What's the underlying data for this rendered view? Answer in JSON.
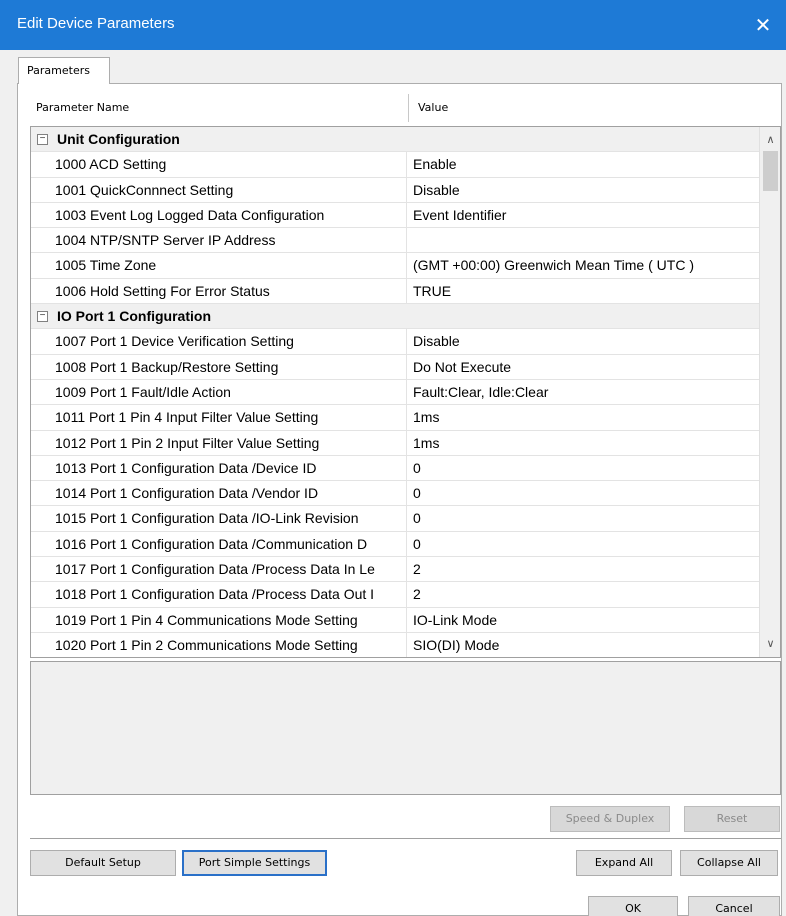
{
  "window": {
    "title": "Edit Device Parameters",
    "close_glyph": "✕"
  },
  "tabs": [
    {
      "label": "Parameters"
    }
  ],
  "grid": {
    "columns": {
      "name": "Parameter Name",
      "value": "Value"
    },
    "rows": [
      {
        "type": "category",
        "name": "Unit Configuration",
        "value": ""
      },
      {
        "type": "param",
        "name": "1000 ACD Setting",
        "value": "Enable"
      },
      {
        "type": "param",
        "name": "1001 QuickConnnect Setting",
        "value": "Disable"
      },
      {
        "type": "param",
        "name": "1003 Event Log Logged Data Configuration",
        "value": "Event Identifier"
      },
      {
        "type": "param",
        "name": "1004 NTP/SNTP Server IP Address",
        "value": ""
      },
      {
        "type": "param",
        "name": "1005 Time Zone",
        "value": "(GMT +00:00) Greenwich Mean Time ( UTC )"
      },
      {
        "type": "param",
        "name": "1006 Hold Setting For Error Status",
        "value": "TRUE"
      },
      {
        "type": "category",
        "name": "IO Port 1 Configuration",
        "value": ""
      },
      {
        "type": "param",
        "name": "1007 Port 1 Device Verification Setting",
        "value": "Disable"
      },
      {
        "type": "param",
        "name": "1008 Port 1 Backup/Restore Setting",
        "value": "Do Not Execute"
      },
      {
        "type": "param",
        "name": "1009 Port 1 Fault/Idle Action",
        "value": "Fault:Clear, Idle:Clear"
      },
      {
        "type": "param",
        "name": "1011 Port 1 Pin 4 Input Filter Value Setting",
        "value": "1ms"
      },
      {
        "type": "param",
        "name": "1012 Port 1 Pin 2 Input Filter Value Setting",
        "value": "1ms"
      },
      {
        "type": "param",
        "name": "1013 Port 1 Configuration Data /Device ID",
        "value": "0"
      },
      {
        "type": "param",
        "name": "1014 Port 1 Configuration Data /Vendor ID",
        "value": "0"
      },
      {
        "type": "param",
        "name": "1015 Port 1 Configuration Data /IO-Link Revision",
        "value": "0"
      },
      {
        "type": "param",
        "name": "1016 Port 1 Configuration Data /Communication D",
        "value": "0"
      },
      {
        "type": "param",
        "name": "1017 Port 1 Configuration Data /Process Data In Le",
        "value": "2"
      },
      {
        "type": "param",
        "name": "1018 Port 1 Configuration Data /Process Data Out I",
        "value": "2"
      },
      {
        "type": "param",
        "name": "1019 Port 1 Pin 4 Communications Mode Setting",
        "value": "IO-Link Mode"
      },
      {
        "type": "param",
        "name": "1020 Port 1 Pin 2 Communications Mode Setting",
        "value": "SIO(DI) Mode"
      }
    ],
    "collapse_glyph": "−",
    "scroll_up_glyph": "∧",
    "scroll_down_glyph": "∨"
  },
  "buttons": {
    "speed_duplex": "Speed & Duplex",
    "reset": "Reset",
    "default_setup": "Default Setup",
    "port_simple_settings": "Port Simple Settings",
    "expand_all": "Expand All",
    "collapse_all": "Collapse All",
    "ok": "OK",
    "cancel": "Cancel"
  }
}
